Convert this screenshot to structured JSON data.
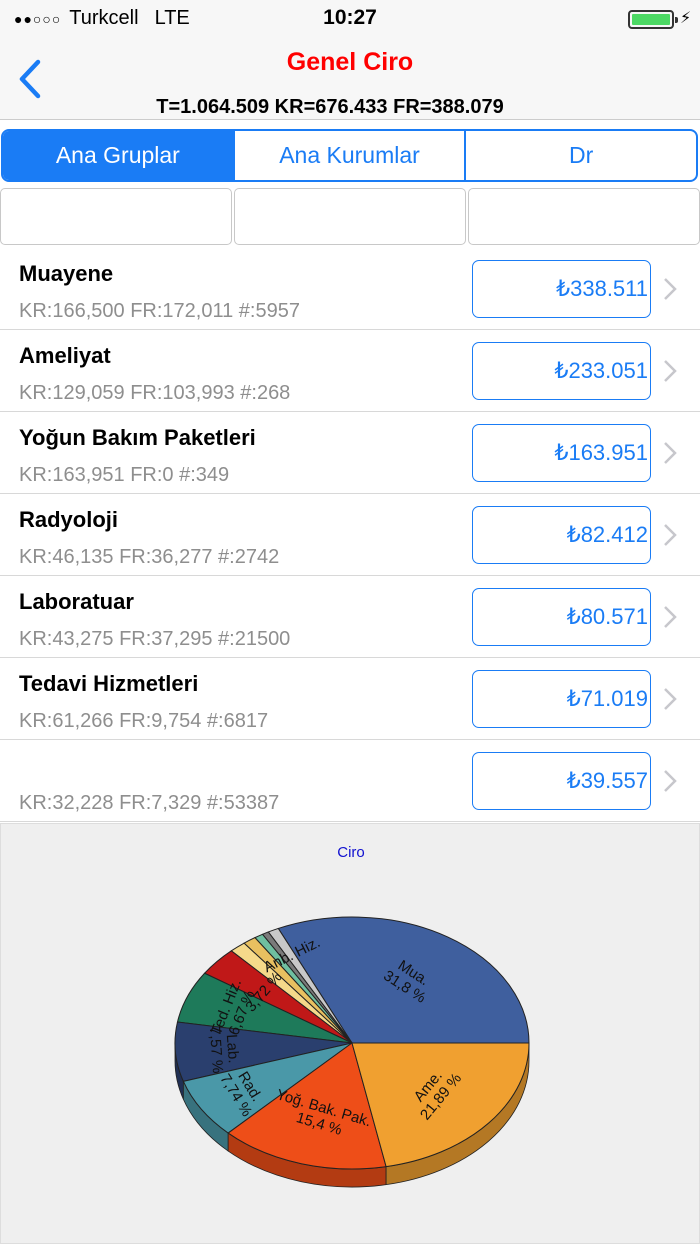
{
  "status": {
    "carrier": "Turkcell",
    "network": "LTE",
    "time": "10:27",
    "signal": "●●○○○",
    "battery_level": 1.0
  },
  "nav": {
    "title": "Genel Ciro",
    "subtitle": "T=1.064.509 KR=676.433 FR=388.079",
    "back_icon": "chevron-left-icon"
  },
  "tabs": [
    {
      "label": "Ana Gruplar",
      "active": true
    },
    {
      "label": "Ana Kurumlar",
      "active": false
    },
    {
      "label": "Dr",
      "active": false
    }
  ],
  "filters": [
    "",
    "",
    ""
  ],
  "rows": [
    {
      "title": "Muayene",
      "sub": "KR:166,500 FR:172,011 #:5957",
      "value": "₺338.511"
    },
    {
      "title": "Ameliyat",
      "sub": "KR:129,059 FR:103,993 #:268",
      "value": "₺233.051"
    },
    {
      "title": "Yoğun Bakım Paketleri",
      "sub": "KR:163,951 FR:0 #:349",
      "value": "₺163.951"
    },
    {
      "title": "Radyoloji",
      "sub": "KR:46,135 FR:36,277 #:2742",
      "value": "₺82.412"
    },
    {
      "title": "Laboratuar",
      "sub": "KR:43,275 FR:37,295 #:21500",
      "value": "₺80.571"
    },
    {
      "title": "Tedavi Hizmetleri",
      "sub": "KR:61,266 FR:9,754 #:6817",
      "value": "₺71.019"
    },
    {
      "title": "",
      "sub": "KR:32,228 FR:7,329 #:53387",
      "value": "₺39.557"
    }
  ],
  "colors": {
    "accent": "#1a7cf5",
    "title_red": "#ff0000",
    "chart_title": "#1010d0"
  },
  "chart_data": {
    "type": "pie",
    "title": "Ciro",
    "slices": [
      {
        "label": "Mua.",
        "value": 31.8,
        "pct_label": "31,8 %",
        "color": "#3f5f9e"
      },
      {
        "label": "Anb. Hiz.",
        "value": 1.0,
        "pct_label": "",
        "color": "#c8c8c8"
      },
      {
        "label": "",
        "value": 0.6,
        "pct_label": "",
        "color": "#7a7a7a"
      },
      {
        "label": "",
        "value": 0.8,
        "pct_label": "",
        "color": "#6fbfa0"
      },
      {
        "label": "",
        "value": 1.2,
        "pct_label": "",
        "color": "#e8c060"
      },
      {
        "label": "",
        "value": 1.5,
        "pct_label": "",
        "color": "#f5d98a"
      },
      {
        "label": "",
        "value": 3.72,
        "pct_label": "3,72 %",
        "color": "#c01818"
      },
      {
        "label": "Ted. Hiz.",
        "value": 6.67,
        "pct_label": "6,67 %",
        "color": "#1e7a5a"
      },
      {
        "label": "Lab.",
        "value": 7.57,
        "pct_label": "7,57 %",
        "color": "#2a3f6e"
      },
      {
        "label": "Rad.",
        "value": 7.74,
        "pct_label": "7,74 %",
        "color": "#4a98a8"
      },
      {
        "label": "Yoğ. Bak. Pak.",
        "value": 15.4,
        "pct_label": "15,4 %",
        "color": "#ee4e18"
      },
      {
        "label": "Ame.",
        "value": 21.89,
        "pct_label": "21,89 %",
        "color": "#f0a030"
      }
    ]
  }
}
